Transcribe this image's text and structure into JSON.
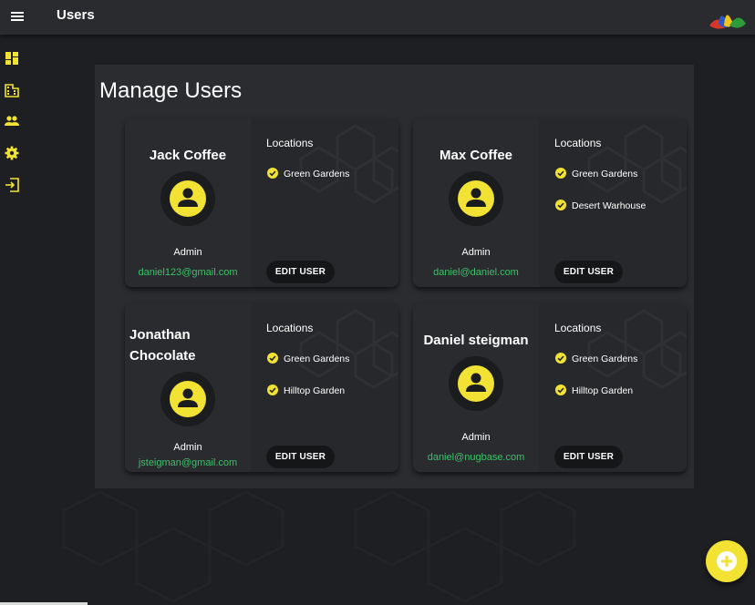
{
  "app": {
    "title": "Users"
  },
  "page": {
    "title": "Manage Users"
  },
  "sidebar": {
    "items": [
      {
        "icon": "dashboard-icon"
      },
      {
        "icon": "building-icon"
      },
      {
        "icon": "people-icon"
      },
      {
        "icon": "settings-icon"
      },
      {
        "icon": "logout-icon"
      }
    ]
  },
  "colors": {
    "accent": "#f2e233",
    "email": "#3fbf6a",
    "background": "#1e1f22",
    "panel": "#2b2c30"
  },
  "locations_heading": "Locations",
  "edit_label": "EDIT USER",
  "users": [
    {
      "name": "Jack Coffee",
      "role": "Admin",
      "email": "daniel123@gmail.com",
      "locations": [
        "Green Gardens"
      ]
    },
    {
      "name": "Max Coffee",
      "role": "Admin",
      "email": "daniel@daniel.com",
      "locations": [
        "Green Gardens",
        "Desert Warhouse"
      ]
    },
    {
      "name_lines": [
        "Jonathan",
        "Chocolate"
      ],
      "role": "Admin",
      "email": "jsteigman@gmail.com",
      "locations": [
        "Green Gardens",
        "Hilltop Garden"
      ]
    },
    {
      "name": "Daniel steigman",
      "role": "Admin",
      "email": "daniel@nugbase.com",
      "locations": [
        "Green Gardens",
        "Hilltop Garden"
      ]
    }
  ]
}
